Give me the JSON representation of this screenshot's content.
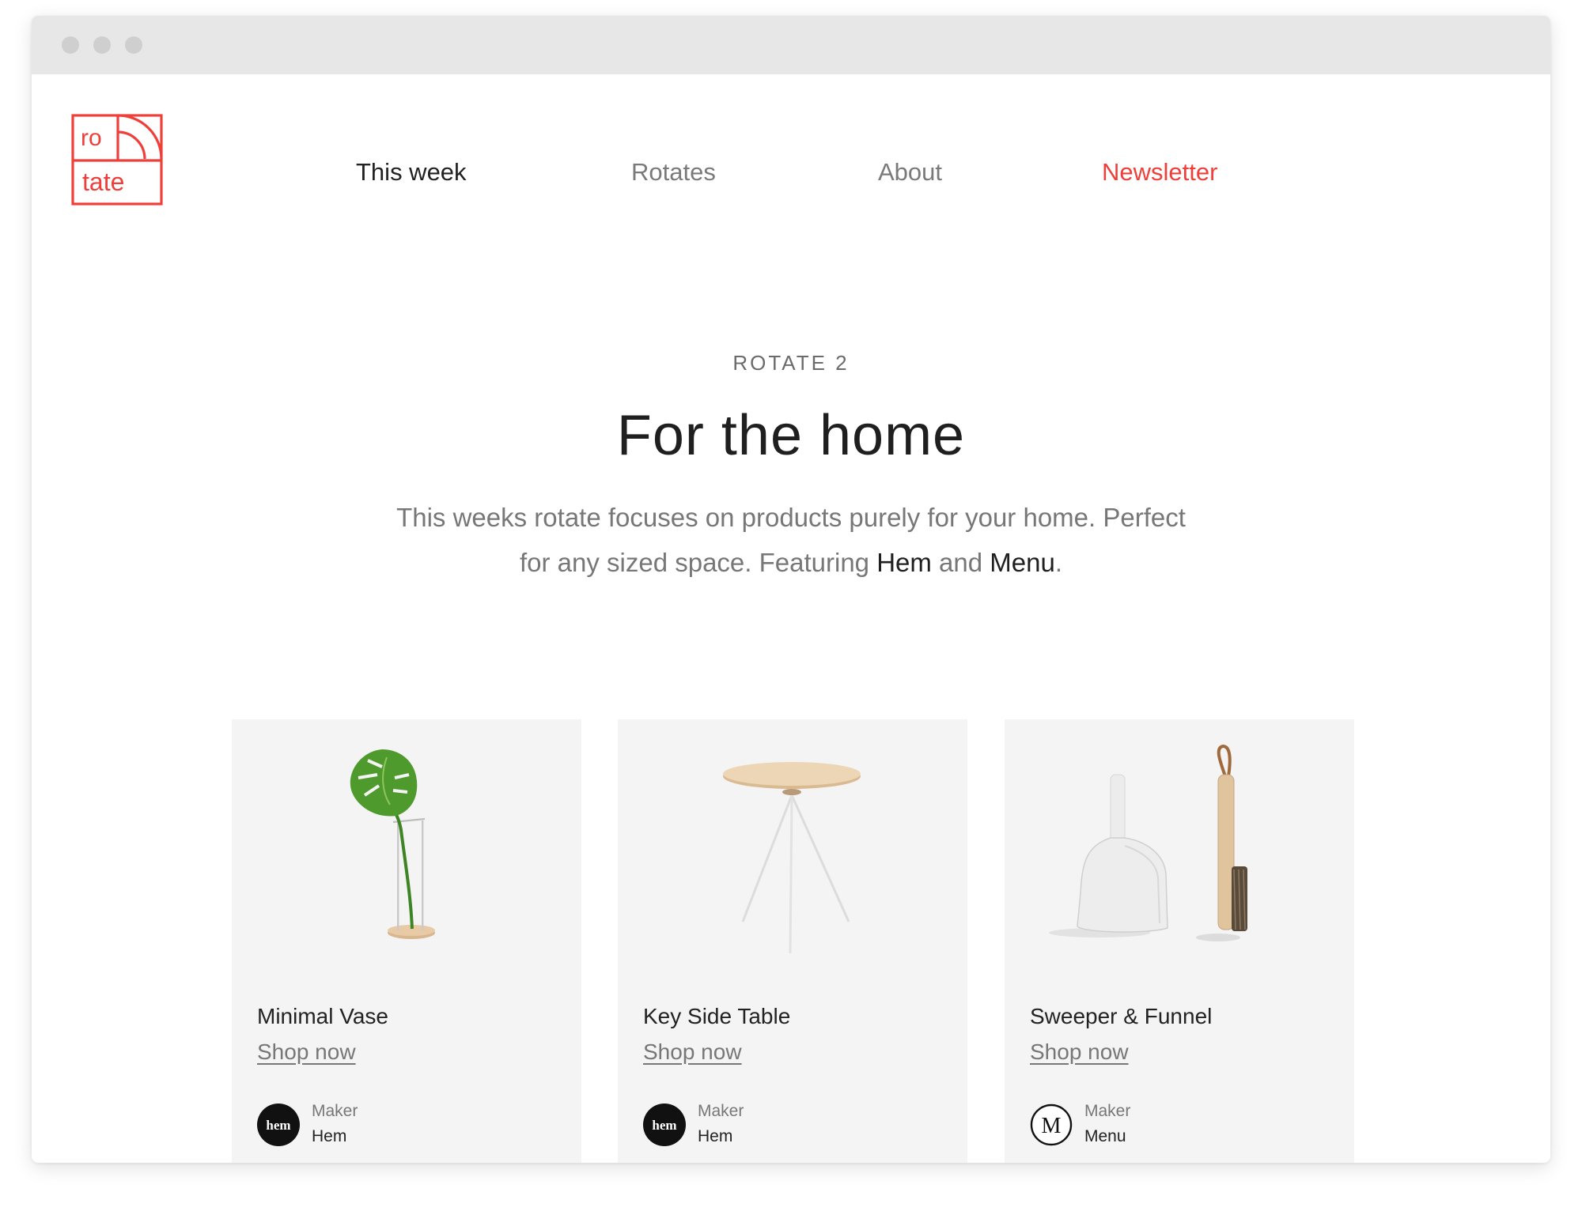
{
  "logo": {
    "line1": "ro",
    "line2": "tate"
  },
  "nav": [
    {
      "label": "This week"
    },
    {
      "label": "Rotates"
    },
    {
      "label": "About"
    },
    {
      "label": "Newsletter"
    }
  ],
  "hero": {
    "eyebrow": "ROTATE 2",
    "title": "For the home",
    "desc_line1": "This weeks rotate focuses on products purely for your home. Perfect",
    "desc_line2_pre": "for any sized space. Featuring ",
    "brand1": "Hem",
    "desc_mid": " and ",
    "brand2": "Menu",
    "desc_end": "."
  },
  "products": [
    {
      "name": "Minimal Vase",
      "cta": "Shop now",
      "maker_label": "Maker",
      "maker": "Hem",
      "maker_logo": "hem"
    },
    {
      "name": "Key Side Table",
      "cta": "Shop now",
      "maker_label": "Maker",
      "maker": "Hem",
      "maker_logo": "hem"
    },
    {
      "name": "Sweeper & Funnel",
      "cta": "Shop now",
      "maker_label": "Maker",
      "maker": "Menu",
      "maker_logo": "M"
    }
  ],
  "colors": {
    "accent": "#ee3f3a",
    "card_bg": "#f4f4f4",
    "titlebar": "#e7e7e7"
  }
}
